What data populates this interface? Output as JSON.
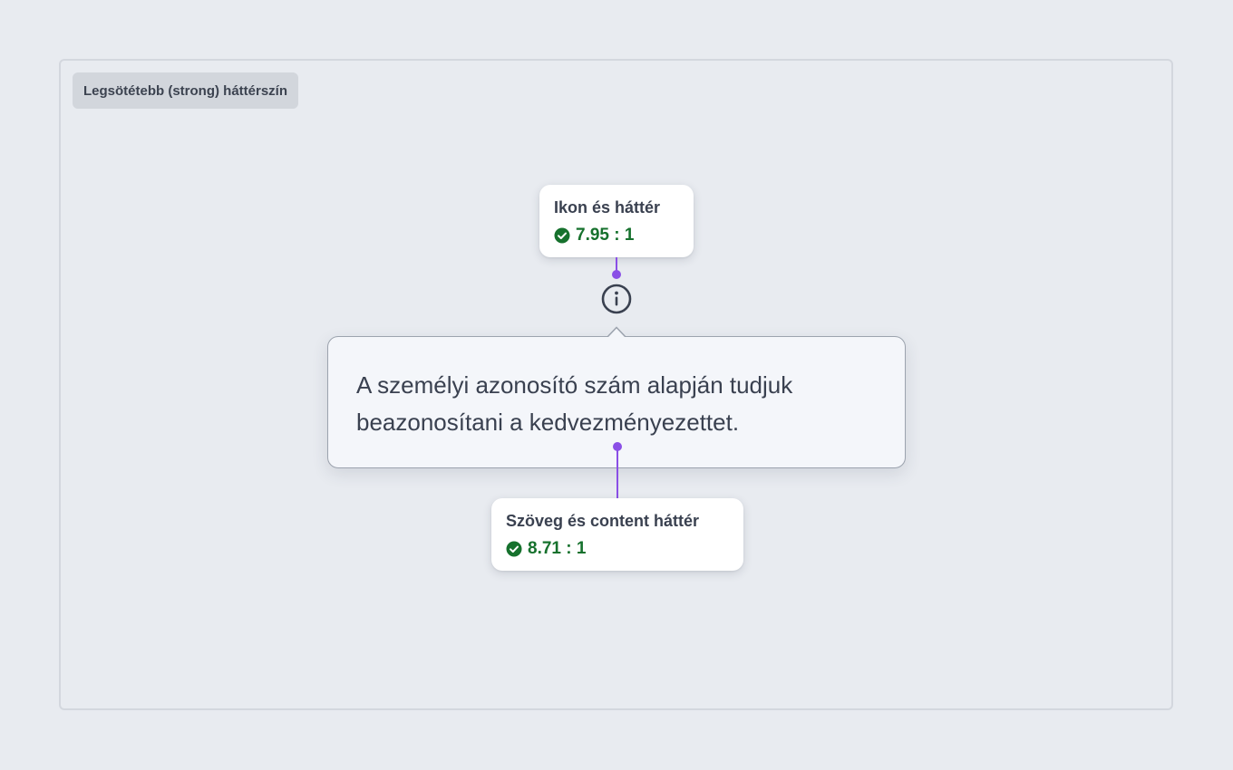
{
  "frame": {
    "label": "Legsötétebb (strong) háttérszín"
  },
  "icon_badge": {
    "title": "Ikon és háttér",
    "ratio": "7.95 : 1",
    "status_icon": "check-circle-icon"
  },
  "tooltip": {
    "text": "A személyi azonosító szám alapján tudjuk beazonosítani a kedvezményezettet.",
    "trigger_icon": "info-icon"
  },
  "text_badge": {
    "title": "Szöveg és content háttér",
    "ratio": "8.71 : 1",
    "status_icon": "check-circle-icon"
  },
  "colors": {
    "background": "#e8ebf0",
    "annotation_line": "#8a4fe6",
    "pass_green": "#16712d",
    "text": "#3a4150"
  }
}
